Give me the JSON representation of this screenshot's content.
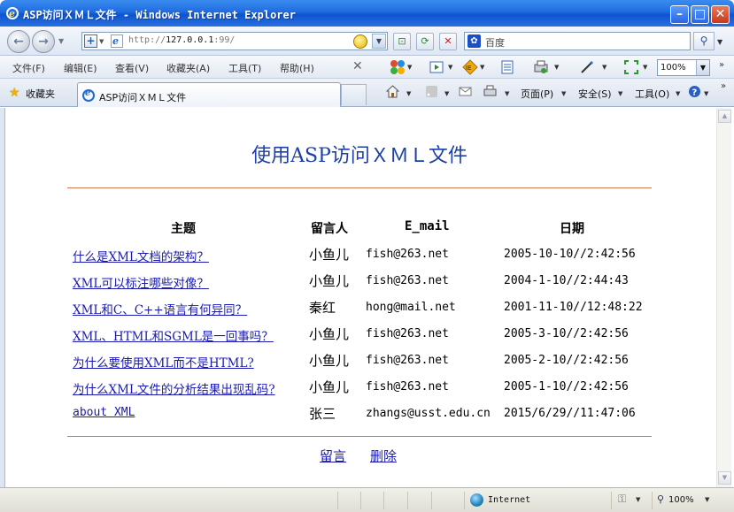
{
  "window": {
    "title": "ASP访问ＸＭＬ文件 - Windows Internet Explorer"
  },
  "address": {
    "url_prefix": "http://",
    "url_host": "127.0.0.1",
    "url_suffix": ":99/"
  },
  "search": {
    "text": "百度"
  },
  "menu": {
    "items": [
      "文件(F)",
      "编辑(E)",
      "查看(V)",
      "收藏夹(A)",
      "工具(T)",
      "帮助(H)"
    ],
    "zoom": "100%"
  },
  "favorites": {
    "label": "收藏夹"
  },
  "tab": {
    "label": "ASP访问ＸＭＬ文件"
  },
  "command_bar": {
    "page": "页面(P)",
    "safety": "安全(S)",
    "tools": "工具(O)"
  },
  "page": {
    "title": "使用ASP访问ＸＭＬ文件",
    "headers": {
      "topic": "主题",
      "author": "留言人",
      "email": "E_mail",
      "date": "日期"
    },
    "rows": [
      {
        "topic": "什么是XML文档的架构？",
        "author": "小鱼儿",
        "email": "fish@263.net",
        "date": "2005-10-10//2:42:56"
      },
      {
        "topic": "XML可以标注哪些对像？",
        "author": "小鱼儿",
        "email": "fish@263.net",
        "date": "2004-1-10//2:44:43"
      },
      {
        "topic": "XML和C、C++语言有何异同？",
        "author": "秦红",
        "email": "hong@mail.net",
        "date": "2001-11-10//12:48:22"
      },
      {
        "topic": "XML、HTML和SGML是一回事吗？",
        "author": "小鱼儿",
        "email": "fish@263.net",
        "date": "2005-3-10//2:42:56"
      },
      {
        "topic": "为什么要使用XML而不是HTML?",
        "author": "小鱼儿",
        "email": "fish@263.net",
        "date": "2005-2-10//2:42:56"
      },
      {
        "topic": "为什么XML文件的分析结果出现乱码?",
        "author": "小鱼儿",
        "email": "fish@263.net",
        "date": "2005-1-10//2:42:56"
      },
      {
        "topic": "about XML",
        "author": "张三",
        "email": "zhangs@usst.edu.cn",
        "date": "2015/6/29//11:47:06"
      }
    ],
    "links": {
      "post": "留言",
      "delete": "删除"
    }
  },
  "status": {
    "zone": "Internet",
    "zoom": "100%"
  }
}
